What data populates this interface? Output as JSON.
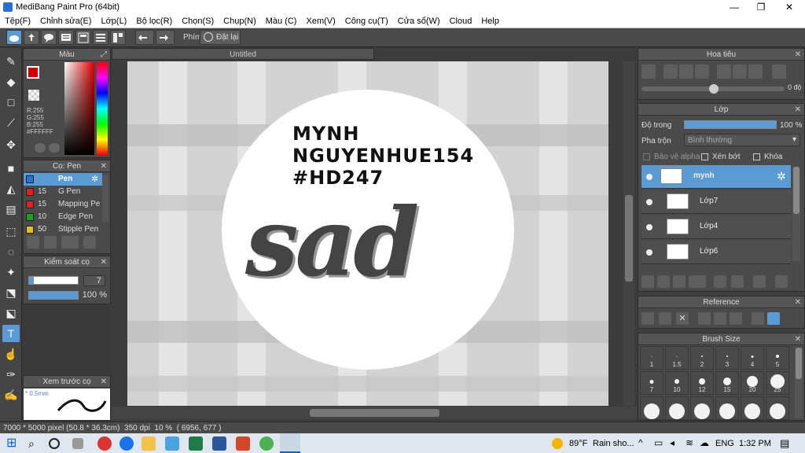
{
  "window": {
    "title": "MediBang Paint Pro (64bit)",
    "minimize": "—",
    "maximize": "❐",
    "close": "✕"
  },
  "menu": [
    "Tệp(F)",
    "Chỉnh sửa(E)",
    "Lớp(L)",
    "Bộ lọc(R)",
    "Chọn(S)",
    "Chụp(N)",
    "Màu (C)",
    "Xem(V)",
    "Công cụ(T)",
    "Cửa sổ(W)",
    "Cloud",
    "Help"
  ],
  "toolbar": {
    "shortcut_label": "Phím",
    "reset_label": "Đặt lại"
  },
  "color_panel": {
    "title": "Màu",
    "r": "R:255",
    "g": "G:255",
    "b": "B:255",
    "hex": "#FFFFFF"
  },
  "brush_panel": {
    "title": "Cọ: Pen",
    "items": [
      {
        "size": "",
        "name": "Pen",
        "color": "#2e6fd0"
      },
      {
        "size": "15",
        "name": "G Pen",
        "color": "#e02020"
      },
      {
        "size": "15",
        "name": "Mapping Pe",
        "color": "#e02020"
      },
      {
        "size": "10",
        "name": "Edge Pen",
        "color": "#20a020"
      },
      {
        "size": "50",
        "name": "Stipple Pen",
        "color": "#e0c020"
      }
    ]
  },
  "brush_control": {
    "title": "Kiểm soát cọ",
    "size": "7",
    "opacity": "100 %"
  },
  "preview": {
    "title": "Xem trước cọ",
    "size_label": "* 0.5mm"
  },
  "document": {
    "tab": "Untitled"
  },
  "artwork": {
    "line1": "MYNH",
    "line2": "NGUYENHUE154",
    "line3": "#HD247",
    "word": "sad"
  },
  "navigator": {
    "title": "Hoa tiêu",
    "angle": "0 độ"
  },
  "layers_panel": {
    "title": "Lớp",
    "opacity_label": "Độ trong",
    "opacity_value": "100 %",
    "blend_label": "Pha trộn",
    "blend_value": "Bình thường",
    "protect_alpha": "Bảo vệ alpha",
    "clipping": "Xén bớt",
    "lock": "Khóa",
    "layers": [
      {
        "name": "mynh",
        "selected": true
      },
      {
        "name": "Lớp7",
        "selected": false
      },
      {
        "name": "Lớp4",
        "selected": false
      },
      {
        "name": "Lớp6",
        "selected": false
      }
    ]
  },
  "reference": {
    "title": "Reference"
  },
  "brush_size": {
    "title": "Brush Size",
    "row1": [
      "1",
      "1.5",
      "2",
      "3",
      "4",
      "5"
    ],
    "row2": [
      "7",
      "10",
      "12",
      "15",
      "20",
      "25"
    ]
  },
  "status": {
    "dims": "7000 * 5000 pixel",
    "mm": "(50.8 * 36.3cm)",
    "dpi": "350 dpi",
    "zoom": "10 %",
    "coords": "( 6956, 677 )"
  },
  "taskbar": {
    "temp": "89°F",
    "weather": "Rain sho...",
    "lang": "ENG",
    "time": "1:32 PM"
  }
}
